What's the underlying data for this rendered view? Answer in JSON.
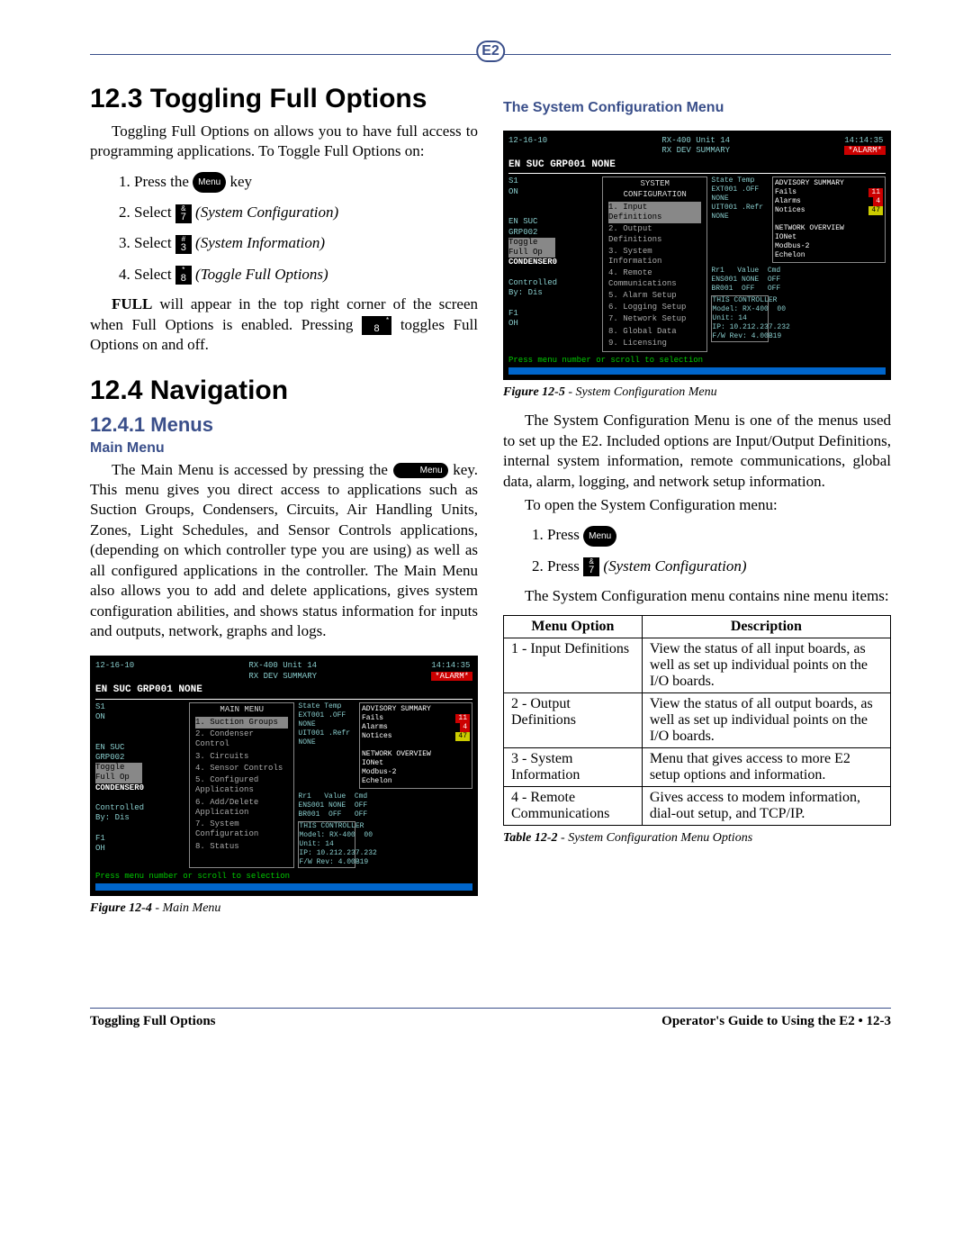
{
  "header": {
    "logo_text": "E2"
  },
  "section_123": {
    "title": "12.3   Toggling Full Options",
    "para1": "Toggling Full Options on allows you to have full access to programming applications. To Toggle Full Options on:",
    "steps": [
      {
        "num": "1.",
        "pre": "Press the ",
        "key_type": "menu",
        "key": "Menu",
        "post": " key"
      },
      {
        "num": "2.",
        "pre": "Select ",
        "key_type": "num",
        "key_sup": "&",
        "key": "7",
        "post_italic": "(System Configuration)"
      },
      {
        "num": "3.",
        "pre": "Select ",
        "key_type": "num",
        "key_sup": "#",
        "key": "3",
        "post_italic": "(System Information)"
      },
      {
        "num": "4.",
        "pre": "Select ",
        "key_type": "num",
        "key_sup": "*",
        "key": "8",
        "post_italic": "(Toggle Full Options)"
      }
    ],
    "para2a": "FULL",
    "para2b": " will appear in the top right corner of the screen when Full Options is enabled. Pressing ",
    "para2_key_sup": "*",
    "para2_key": "8",
    "para2c": " toggles Full Options on and off."
  },
  "section_124": {
    "title": "12.4   Navigation",
    "sub_1241": "12.4.1   Menus",
    "mainmenu_h": "Main Menu",
    "mainmenu_p_a": "The Main Menu is accessed by pressing the ",
    "mainmenu_key": "Menu",
    "mainmenu_p_b": " key. This menu gives you direct access to applications such as Suction Groups, Condensers, Circuits, Air Handling Units, Zones, Light Schedules, and Sensor Controls applications, (depending on which controller type you are using) as well as all configured applications in the controller. The Main Menu also allows you to add and delete applications, gives system configuration abilities, and shows status information for inputs and outputs, network, graphs and logs."
  },
  "screen_main": {
    "date": "12-16-10",
    "unit": "RX-400 Unit 14",
    "subunit": "RX DEV SUMMARY",
    "time": "14:14:35",
    "alarm": "*ALARM*",
    "grp": "EN  SUC  GRP001   NONE",
    "state": "State Temp",
    "ext1": "EXT001  .OFF  NONE",
    "ext2": "UIT001 .Refr NONE",
    "advisory_title": "ADVISORY SUMMARY",
    "adv_fails": "Fails",
    "adv_fails_n": "11",
    "adv_alarms": "Alarms",
    "adv_alarms_n": "4",
    "adv_notices": "Notices",
    "adv_notices_n": "47",
    "s1": "S1",
    "on": "ON",
    "net_title": "NETWORK OVERVIEW",
    "net_a": "IONet",
    "net_b": "Modbus-2",
    "net_c": "Echelon",
    "menu_title": "MAIN MENU",
    "items": [
      "1.  Suction Groups",
      "2.  Condenser Control",
      "3.  Circuits",
      "4.  Sensor Controls",
      "5.  Configured Applications",
      "6.  Add/Delete Application",
      "7.  System Configuration",
      "8.  Status"
    ],
    "side1": "EN SUC GRP002",
    "side2": "Toggle Full Op",
    "side3": "CONDENSER0",
    "ctrl": "Controlled By: Dis",
    "f1": "F1",
    "oh": "OH",
    "ctrl_box": "THIS CONTROLLER\nModel: RX-400  00\nUnit: 14\nIP: 10.212.237.232\nF/W Rev: 4.00B19",
    "rv": "Rr1   Value  Cmd\nENS001 NONE  OFF\nBR001  OFF   OFF",
    "hint": "Press menu number or scroll to selection"
  },
  "fig124": {
    "lead": "Figure 12-4",
    "rest": " - Main Menu"
  },
  "syscfg_h": "The System Configuration Menu",
  "screen_sys": {
    "menu_title": "SYSTEM CONFIGURATION",
    "items": [
      "1.  Input Definitions",
      "2.  Output Definitions",
      "3.  System Information",
      "4.  Remote Communications",
      "5.  Alarm Setup",
      "6.  Logging Setup",
      "7.  Network Setup",
      "8.  Global Data",
      "9.  Licensing"
    ]
  },
  "fig125": {
    "lead": "Figure 12-5",
    "rest": " - System Configuration Menu"
  },
  "syscfg_p1": "The System Configuration Menu is one of the menus used to set up the E2. Included options are Input/Output Definitions, internal system information, remote communications, global data, alarm, logging, and network setup information.",
  "syscfg_p2": "To open the System Configuration menu:",
  "syscfg_steps": [
    {
      "num": "1.",
      "pre": "Press ",
      "key_type": "menu",
      "key": "Menu"
    },
    {
      "num": "2.",
      "pre": "Press ",
      "key_type": "num",
      "key_sup": "&",
      "key": "7",
      "post_italic": "(System Configuration)"
    }
  ],
  "syscfg_p3": "The System Configuration menu contains nine menu items:",
  "table": {
    "h1": "Menu Option",
    "h2": "Description",
    "rows": [
      {
        "opt": "1 - Input Definitions",
        "desc": "View the status of all input boards, as well as set up individual points on the I/O boards."
      },
      {
        "opt": "2 - Output Definitions",
        "desc": "View the status of all output boards, as well as set up individual points on the I/O boards."
      },
      {
        "opt": "3 - System Information",
        "desc": "Menu that gives access to more E2 setup options and information."
      },
      {
        "opt": "4 - Remote Communications",
        "desc": "Gives access to modem information, dial-out setup, and TCP/IP."
      }
    ]
  },
  "tab122": {
    "lead": "Table 12-2",
    "rest": " - System Configuration Menu Options"
  },
  "footer": {
    "left": "Toggling Full Options",
    "right": "Operator's Guide to Using the E2 • 12-3"
  }
}
